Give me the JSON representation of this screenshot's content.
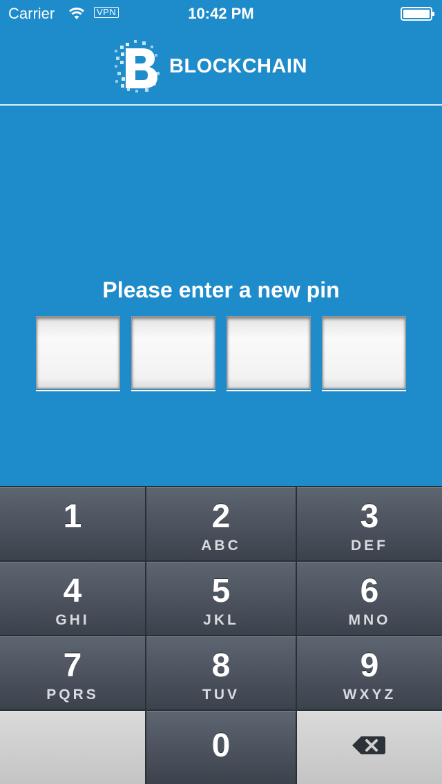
{
  "status_bar": {
    "carrier": "Carrier",
    "vpn": "VPN",
    "time": "10:42 PM"
  },
  "header": {
    "logo_text": "BLOCKCHAIN"
  },
  "pin_entry": {
    "prompt": "Please enter a new pin",
    "digits_entered": 0,
    "digit_slots": 4
  },
  "keypad": {
    "keys": [
      {
        "digit": "1",
        "letters": ""
      },
      {
        "digit": "2",
        "letters": "ABC"
      },
      {
        "digit": "3",
        "letters": "DEF"
      },
      {
        "digit": "4",
        "letters": "GHI"
      },
      {
        "digit": "5",
        "letters": "JKL"
      },
      {
        "digit": "6",
        "letters": "MNO"
      },
      {
        "digit": "7",
        "letters": "PQRS"
      },
      {
        "digit": "8",
        "letters": "TUV"
      },
      {
        "digit": "9",
        "letters": "WXYZ"
      },
      {
        "digit": "0",
        "letters": ""
      }
    ],
    "delete_icon": "backspace-icon"
  },
  "colors": {
    "background": "#1e8bcb",
    "keypad_key": "#4d545f",
    "keypad_light_key": "#cfcfcf"
  }
}
